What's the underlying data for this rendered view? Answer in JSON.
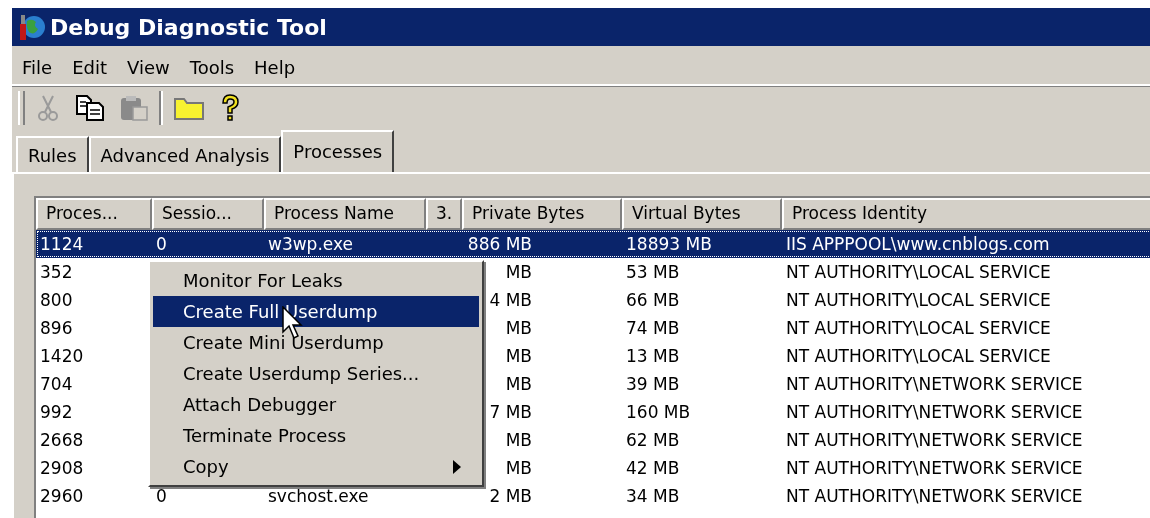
{
  "window": {
    "title": "Debug Diagnostic Tool"
  },
  "menu": [
    {
      "label": "File"
    },
    {
      "label": "Edit"
    },
    {
      "label": "View"
    },
    {
      "label": "Tools"
    },
    {
      "label": "Help"
    }
  ],
  "toolbar": [
    {
      "kind": "cut",
      "disabled": true
    },
    {
      "kind": "copy",
      "disabled": false
    },
    {
      "kind": "paste",
      "disabled": true
    },
    {
      "kind": "open",
      "disabled": false
    },
    {
      "kind": "help",
      "disabled": false
    }
  ],
  "tabs": [
    {
      "label": "Rules",
      "selected": false
    },
    {
      "label": "Advanced Analysis",
      "selected": false
    },
    {
      "label": "Processes",
      "selected": true
    }
  ],
  "table": {
    "columns": [
      "Proces...",
      "Sessio...",
      "Process Name",
      "3.",
      "Private Bytes",
      "Virtual Bytes",
      "Process Identity"
    ],
    "rows": [
      {
        "pid": "1124",
        "session": "0",
        "name": "w3wp.exe",
        "private_bytes": "886 MB",
        "virtual_bytes": "18893 MB",
        "identity": "IIS APPPOOL\\www.cnblogs.com",
        "selected": true
      },
      {
        "pid": "352",
        "private_bytes": "MB",
        "virtual_bytes": "53 MB",
        "identity": "NT AUTHORITY\\LOCAL SERVICE",
        "selected": false
      },
      {
        "pid": "800",
        "private_bytes": "4 MB",
        "virtual_bytes": "66 MB",
        "identity": "NT AUTHORITY\\LOCAL SERVICE",
        "selected": false
      },
      {
        "pid": "896",
        "private_bytes": "MB",
        "virtual_bytes": "74 MB",
        "identity": "NT AUTHORITY\\LOCAL SERVICE",
        "selected": false
      },
      {
        "pid": "1420",
        "private_bytes": "MB",
        "virtual_bytes": "13 MB",
        "identity": "NT AUTHORITY\\LOCAL SERVICE",
        "selected": false
      },
      {
        "pid": "704",
        "private_bytes": "MB",
        "virtual_bytes": "39 MB",
        "identity": "NT AUTHORITY\\NETWORK SERVICE",
        "selected": false
      },
      {
        "pid": "992",
        "private_bytes": "7 MB",
        "virtual_bytes": "160 MB",
        "identity": "NT AUTHORITY\\NETWORK SERVICE",
        "selected": false
      },
      {
        "pid": "2668",
        "private_bytes": "MB",
        "virtual_bytes": "62 MB",
        "identity": "NT AUTHORITY\\NETWORK SERVICE",
        "selected": false
      },
      {
        "pid": "2908",
        "private_bytes": "MB",
        "virtual_bytes": "42 MB",
        "identity": "NT AUTHORITY\\NETWORK SERVICE",
        "selected": false
      },
      {
        "pid": "2960",
        "session": "0",
        "name": "svchost.exe",
        "private_bytes": "2 MB",
        "virtual_bytes": "34 MB",
        "identity": "NT AUTHORITY\\NETWORK SERVICE",
        "selected": false
      }
    ]
  },
  "context_menu": {
    "items": [
      {
        "label": "Monitor For Leaks",
        "selected": false,
        "submenu": false
      },
      {
        "label": "Create Full Userdump",
        "selected": true,
        "submenu": false
      },
      {
        "label": "Create Mini Userdump",
        "selected": false,
        "submenu": false
      },
      {
        "label": "Create Userdump Series...",
        "selected": false,
        "submenu": false
      },
      {
        "label": "Attach Debugger",
        "selected": false,
        "submenu": false
      },
      {
        "label": "Terminate Process",
        "selected": false,
        "submenu": false
      },
      {
        "label": "Copy",
        "selected": false,
        "submenu": true
      }
    ]
  }
}
